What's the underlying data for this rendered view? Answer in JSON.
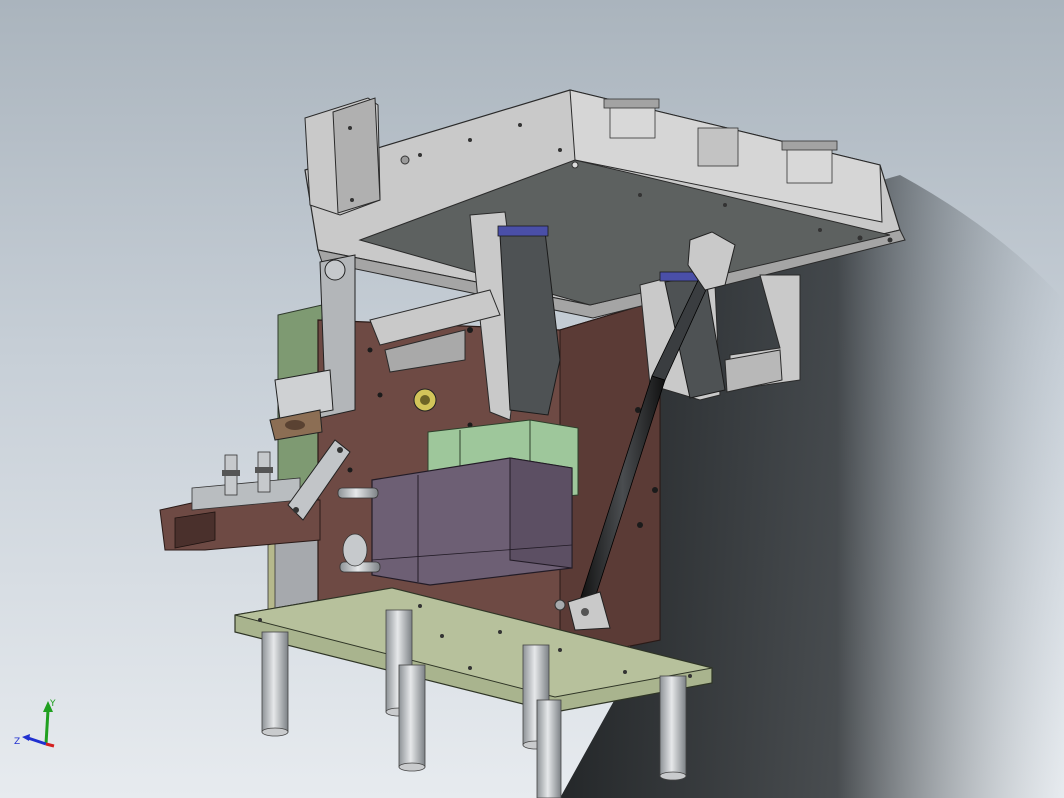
{
  "viewport": {
    "background_top": "#aab4bd",
    "background_bottom": "#e7ebef"
  },
  "triad": {
    "x_label": "",
    "y_label": "Y",
    "z_label": "Z",
    "x_color": "#d42020",
    "y_color": "#20a020",
    "z_color": "#2030d0"
  },
  "colors": {
    "top_plate": "#c9c9c9",
    "top_plate_underside": "#5d6160",
    "back_plate": "#6e4a44",
    "base_plate": "#a9b48e",
    "green_panel": "#7e9a72",
    "purple_block": "#6d5f74",
    "green_block": "#9ec79b",
    "steel": "#b9bdc0",
    "rod": "#262829",
    "bracket_blue": "#4a4fa8"
  }
}
